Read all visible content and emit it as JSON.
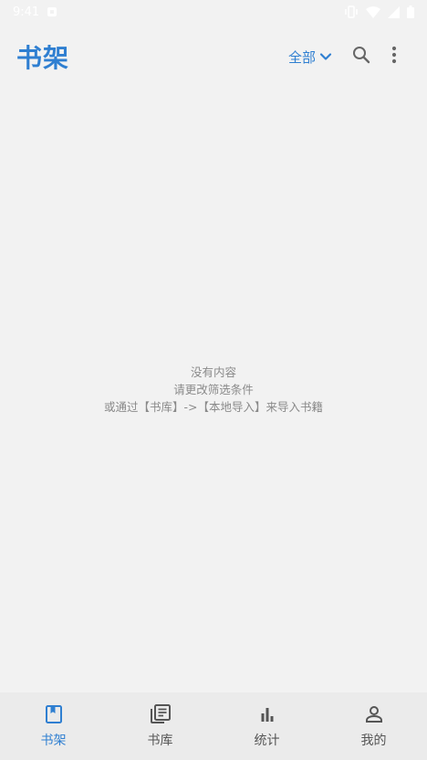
{
  "status_bar": {
    "time": "9:41"
  },
  "header": {
    "title": "书架",
    "filter_label": "全部"
  },
  "empty_state": {
    "line1": "没有内容",
    "line2": "请更改筛选条件",
    "line3": "或通过【书库】->【本地导入】来导入书籍"
  },
  "bottom_nav": {
    "items": [
      {
        "label": "书架",
        "icon": "bookmark-book-icon",
        "active": true
      },
      {
        "label": "书库",
        "icon": "library-icon",
        "active": false
      },
      {
        "label": "统计",
        "icon": "bar-chart-icon",
        "active": false
      },
      {
        "label": "我的",
        "icon": "person-icon",
        "active": false
      }
    ]
  },
  "colors": {
    "accent": "#2f7fd1",
    "background": "#f2f2f2",
    "nav_background": "#ebebeb",
    "inactive": "#555555",
    "muted_text": "#8a8a8a"
  }
}
